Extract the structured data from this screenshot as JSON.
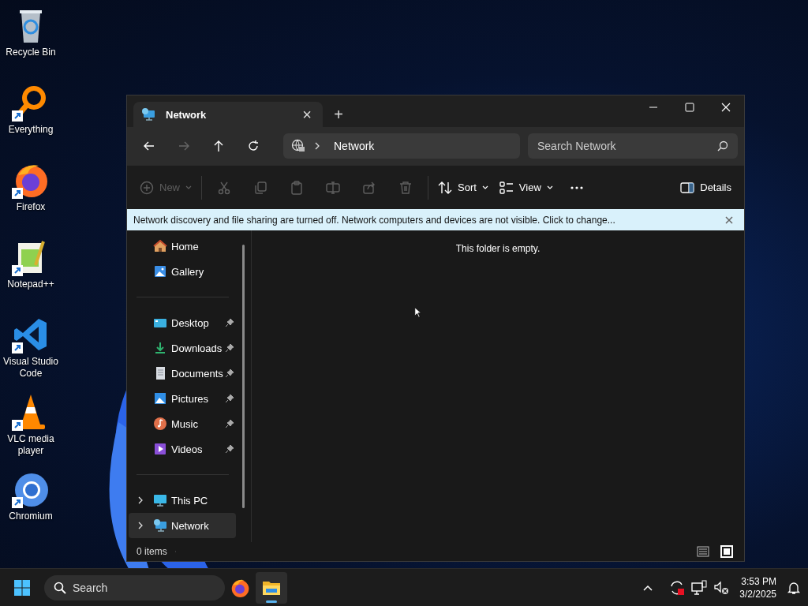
{
  "desktop_icons": [
    {
      "kind": "recycle",
      "label": "Recycle Bin",
      "shortcut": false
    },
    {
      "kind": "everything",
      "label": "Everything",
      "shortcut": true
    },
    {
      "kind": "firefox",
      "label": "Firefox",
      "shortcut": true
    },
    {
      "kind": "notepad",
      "label": "Notepad++",
      "shortcut": true
    },
    {
      "kind": "vscode",
      "label": "Visual Studio Code",
      "shortcut": true
    },
    {
      "kind": "vlc",
      "label": "VLC media player",
      "shortcut": true
    },
    {
      "kind": "chromium",
      "label": "Chromium",
      "shortcut": true
    }
  ],
  "window": {
    "tab": {
      "title": "Network",
      "close": "×"
    },
    "new_tab": "+",
    "nav": {
      "back_disabled": false,
      "forward_disabled": true,
      "address": "Network",
      "search_placeholder": "Search Network"
    },
    "toolbar_groups": [
      [
        {
          "kind": "new",
          "label": "New",
          "disabled": true,
          "dropdown": true
        }
      ],
      [
        {
          "kind": "cut",
          "disabled": true
        },
        {
          "kind": "copy",
          "disabled": true
        },
        {
          "kind": "paste",
          "disabled": true
        },
        {
          "kind": "rename",
          "disabled": true
        },
        {
          "kind": "share",
          "disabled": true
        },
        {
          "kind": "delete",
          "disabled": true
        }
      ],
      [
        {
          "kind": "sort",
          "label": "Sort",
          "disabled": false,
          "dropdown": true
        },
        {
          "kind": "view",
          "label": "View",
          "disabled": false,
          "dropdown": true
        },
        {
          "kind": "more",
          "disabled": false
        }
      ]
    ],
    "details_button": "Details",
    "banner": "Network discovery and file sharing are turned off. Network computers and devices are not visible. Click to change...",
    "sidebar_sections": [
      [
        {
          "kind": "home",
          "label": "Home",
          "selected": false
        },
        {
          "kind": "gallery",
          "label": "Gallery",
          "selected": false
        }
      ],
      [
        {
          "kind": "desktop",
          "label": "Desktop",
          "pinned": true,
          "selected": false
        },
        {
          "kind": "downloads",
          "label": "Downloads",
          "pinned": true,
          "selected": false
        },
        {
          "kind": "documents",
          "label": "Documents",
          "pinned": true,
          "selected": false
        },
        {
          "kind": "pictures",
          "label": "Pictures",
          "pinned": true,
          "selected": false
        },
        {
          "kind": "music",
          "label": "Music",
          "pinned": true,
          "selected": false
        },
        {
          "kind": "videos",
          "label": "Videos",
          "pinned": true,
          "selected": false
        }
      ],
      [
        {
          "kind": "pc",
          "label": "This PC",
          "expanded": false,
          "selected": false
        },
        {
          "kind": "network",
          "label": "Network",
          "expanded": false,
          "selected": true
        }
      ]
    ],
    "empty_message": "This folder is empty.",
    "status": {
      "items": "0 items",
      "views": [
        {
          "kind": "details",
          "selected": false
        },
        {
          "kind": "tiles",
          "selected": true
        }
      ]
    }
  },
  "taskbar": {
    "search_placeholder": "Search",
    "apps": [
      {
        "kind": "firefox",
        "active": false
      },
      {
        "kind": "explorer",
        "active": true
      }
    ],
    "time": "3:53 PM",
    "date": "3/2/2025"
  }
}
